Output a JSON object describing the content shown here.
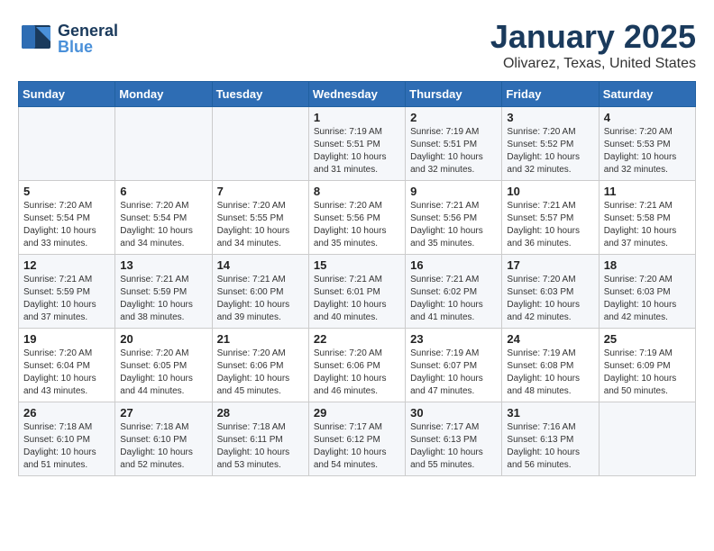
{
  "header": {
    "logo_general": "General",
    "logo_blue": "Blue",
    "month": "January 2025",
    "location": "Olivarez, Texas, United States"
  },
  "weekdays": [
    "Sunday",
    "Monday",
    "Tuesday",
    "Wednesday",
    "Thursday",
    "Friday",
    "Saturday"
  ],
  "weeks": [
    [
      {
        "day": "",
        "info": ""
      },
      {
        "day": "",
        "info": ""
      },
      {
        "day": "",
        "info": ""
      },
      {
        "day": "1",
        "info": "Sunrise: 7:19 AM\nSunset: 5:51 PM\nDaylight: 10 hours\nand 31 minutes."
      },
      {
        "day": "2",
        "info": "Sunrise: 7:19 AM\nSunset: 5:51 PM\nDaylight: 10 hours\nand 32 minutes."
      },
      {
        "day": "3",
        "info": "Sunrise: 7:20 AM\nSunset: 5:52 PM\nDaylight: 10 hours\nand 32 minutes."
      },
      {
        "day": "4",
        "info": "Sunrise: 7:20 AM\nSunset: 5:53 PM\nDaylight: 10 hours\nand 32 minutes."
      }
    ],
    [
      {
        "day": "5",
        "info": "Sunrise: 7:20 AM\nSunset: 5:54 PM\nDaylight: 10 hours\nand 33 minutes."
      },
      {
        "day": "6",
        "info": "Sunrise: 7:20 AM\nSunset: 5:54 PM\nDaylight: 10 hours\nand 34 minutes."
      },
      {
        "day": "7",
        "info": "Sunrise: 7:20 AM\nSunset: 5:55 PM\nDaylight: 10 hours\nand 34 minutes."
      },
      {
        "day": "8",
        "info": "Sunrise: 7:20 AM\nSunset: 5:56 PM\nDaylight: 10 hours\nand 35 minutes."
      },
      {
        "day": "9",
        "info": "Sunrise: 7:21 AM\nSunset: 5:56 PM\nDaylight: 10 hours\nand 35 minutes."
      },
      {
        "day": "10",
        "info": "Sunrise: 7:21 AM\nSunset: 5:57 PM\nDaylight: 10 hours\nand 36 minutes."
      },
      {
        "day": "11",
        "info": "Sunrise: 7:21 AM\nSunset: 5:58 PM\nDaylight: 10 hours\nand 37 minutes."
      }
    ],
    [
      {
        "day": "12",
        "info": "Sunrise: 7:21 AM\nSunset: 5:59 PM\nDaylight: 10 hours\nand 37 minutes."
      },
      {
        "day": "13",
        "info": "Sunrise: 7:21 AM\nSunset: 5:59 PM\nDaylight: 10 hours\nand 38 minutes."
      },
      {
        "day": "14",
        "info": "Sunrise: 7:21 AM\nSunset: 6:00 PM\nDaylight: 10 hours\nand 39 minutes."
      },
      {
        "day": "15",
        "info": "Sunrise: 7:21 AM\nSunset: 6:01 PM\nDaylight: 10 hours\nand 40 minutes."
      },
      {
        "day": "16",
        "info": "Sunrise: 7:21 AM\nSunset: 6:02 PM\nDaylight: 10 hours\nand 41 minutes."
      },
      {
        "day": "17",
        "info": "Sunrise: 7:20 AM\nSunset: 6:03 PM\nDaylight: 10 hours\nand 42 minutes."
      },
      {
        "day": "18",
        "info": "Sunrise: 7:20 AM\nSunset: 6:03 PM\nDaylight: 10 hours\nand 42 minutes."
      }
    ],
    [
      {
        "day": "19",
        "info": "Sunrise: 7:20 AM\nSunset: 6:04 PM\nDaylight: 10 hours\nand 43 minutes."
      },
      {
        "day": "20",
        "info": "Sunrise: 7:20 AM\nSunset: 6:05 PM\nDaylight: 10 hours\nand 44 minutes."
      },
      {
        "day": "21",
        "info": "Sunrise: 7:20 AM\nSunset: 6:06 PM\nDaylight: 10 hours\nand 45 minutes."
      },
      {
        "day": "22",
        "info": "Sunrise: 7:20 AM\nSunset: 6:06 PM\nDaylight: 10 hours\nand 46 minutes."
      },
      {
        "day": "23",
        "info": "Sunrise: 7:19 AM\nSunset: 6:07 PM\nDaylight: 10 hours\nand 47 minutes."
      },
      {
        "day": "24",
        "info": "Sunrise: 7:19 AM\nSunset: 6:08 PM\nDaylight: 10 hours\nand 48 minutes."
      },
      {
        "day": "25",
        "info": "Sunrise: 7:19 AM\nSunset: 6:09 PM\nDaylight: 10 hours\nand 50 minutes."
      }
    ],
    [
      {
        "day": "26",
        "info": "Sunrise: 7:18 AM\nSunset: 6:10 PM\nDaylight: 10 hours\nand 51 minutes."
      },
      {
        "day": "27",
        "info": "Sunrise: 7:18 AM\nSunset: 6:10 PM\nDaylight: 10 hours\nand 52 minutes."
      },
      {
        "day": "28",
        "info": "Sunrise: 7:18 AM\nSunset: 6:11 PM\nDaylight: 10 hours\nand 53 minutes."
      },
      {
        "day": "29",
        "info": "Sunrise: 7:17 AM\nSunset: 6:12 PM\nDaylight: 10 hours\nand 54 minutes."
      },
      {
        "day": "30",
        "info": "Sunrise: 7:17 AM\nSunset: 6:13 PM\nDaylight: 10 hours\nand 55 minutes."
      },
      {
        "day": "31",
        "info": "Sunrise: 7:16 AM\nSunset: 6:13 PM\nDaylight: 10 hours\nand 56 minutes."
      },
      {
        "day": "",
        "info": ""
      }
    ]
  ]
}
